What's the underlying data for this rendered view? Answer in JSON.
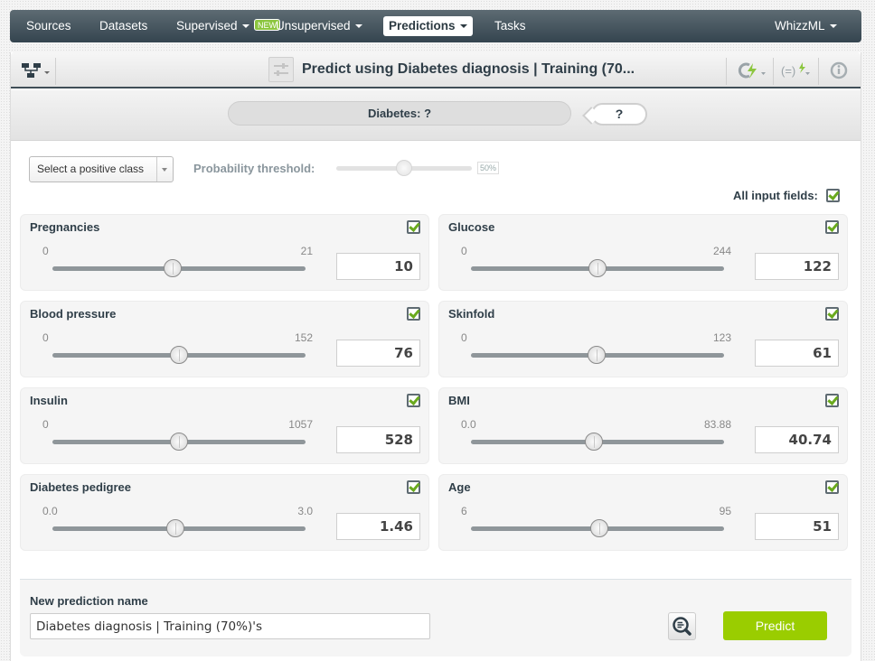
{
  "nav": {
    "items": [
      {
        "label": "Sources",
        "dropdown": false,
        "active": false
      },
      {
        "label": "Datasets",
        "dropdown": false,
        "active": false
      },
      {
        "label": "Supervised",
        "dropdown": true,
        "active": false
      },
      {
        "label": "Unsupervised",
        "dropdown": true,
        "active": false
      },
      {
        "label": "Predictions",
        "dropdown": true,
        "active": true
      },
      {
        "label": "Tasks",
        "dropdown": false,
        "active": false
      }
    ],
    "new_badge": "NEW",
    "right_item": {
      "label": "WhizzML",
      "dropdown": true
    }
  },
  "toolbar": {
    "left_icon": "model-tree-icon",
    "title_icon": "sliders-icon",
    "title": "Predict using Diabetes diagnosis | Training (70...",
    "right_icons": [
      "batch-predict-icon",
      "whizzml-script-icon",
      "info-icon"
    ],
    "accent_green": "#8cc63f"
  },
  "prediction": {
    "objective_label": "Diabetes: ?",
    "result": "?"
  },
  "options": {
    "positive_class_placeholder": "Select a positive class",
    "threshold_label": "Probability threshold:",
    "threshold_value": "50%",
    "threshold_fraction": 0.5,
    "all_fields_label": "All input fields:",
    "all_fields_checked": true
  },
  "fields": [
    {
      "name": "Pregnancies",
      "min": "0",
      "max": "21",
      "value": "10",
      "checked": true
    },
    {
      "name": "Glucose",
      "min": "0",
      "max": "244",
      "value": "122",
      "checked": true
    },
    {
      "name": "Blood pressure",
      "min": "0",
      "max": "152",
      "value": "76",
      "checked": true
    },
    {
      "name": "Skinfold",
      "min": "0",
      "max": "123",
      "value": "61",
      "checked": true
    },
    {
      "name": "Insulin",
      "min": "0",
      "max": "1057",
      "value": "528",
      "checked": true
    },
    {
      "name": "BMI",
      "min": "0.0",
      "max": "83.88",
      "value": "40.74",
      "checked": true
    },
    {
      "name": "Diabetes pedigree",
      "min": "0.0",
      "max": "3.0",
      "value": "1.46",
      "checked": true
    },
    {
      "name": "Age",
      "min": "6",
      "max": "95",
      "value": "51",
      "checked": true
    }
  ],
  "footer": {
    "name_label": "New prediction name",
    "name_value": "Diabetes diagnosis | Training (70%)'s",
    "preview_icon": "preview-search-icon",
    "predict_label": "Predict",
    "predict_color": "#9acd00"
  }
}
